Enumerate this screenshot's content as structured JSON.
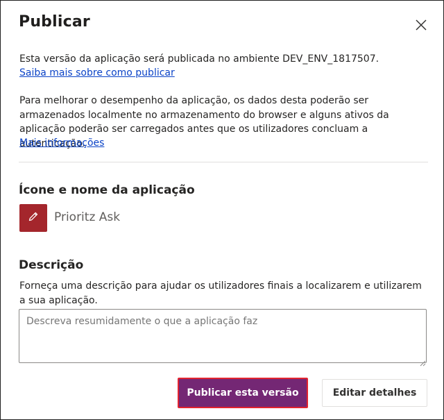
{
  "dialog": {
    "title": "Publicar",
    "close_icon": "close-icon"
  },
  "publish_info": {
    "text": "Esta versão da aplicação será publicada no ambiente DEV_ENV_1817507.",
    "link": "Saiba mais sobre como publicar"
  },
  "performance_info": {
    "text": "Para melhorar o desempenho da aplicação, os dados desta poderão ser armazenados localmente no armazenamento do browser e alguns ativos da aplicação poderão ser carregados antes que os utilizadores concluam a autenticação.",
    "link": "Mais informações"
  },
  "app_section": {
    "title": "Ícone e nome da aplicação",
    "icon": "pencil-icon",
    "icon_bg_color": "#a4262c",
    "app_name": "Prioritz Ask"
  },
  "description_section": {
    "title": "Descrição",
    "help_text": "Forneça uma descrição para ajudar os utilizadores finais a localizarem e utilizarem a sua aplicação.",
    "placeholder": "Descreva resumidamente o que a aplicação faz",
    "value": ""
  },
  "buttons": {
    "publish_label": "Publicar esta versão",
    "publish_color": "#742774",
    "publish_highlight_color": "#e3232f",
    "edit_label": "Editar detalhes"
  }
}
